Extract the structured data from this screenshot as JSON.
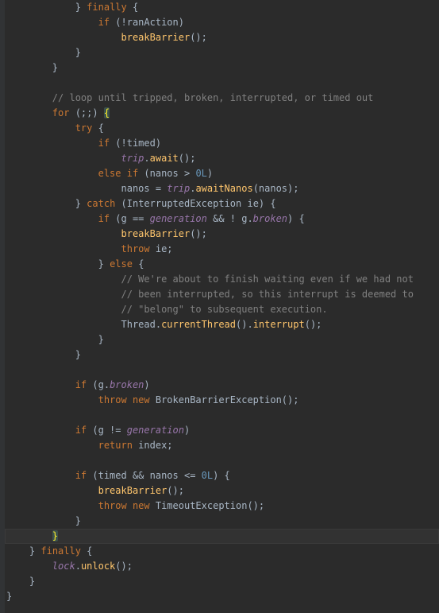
{
  "lines": [
    {
      "indent": "            ",
      "tokens": [
        {
          "t": "}",
          "c": "id"
        },
        {
          "t": " ",
          "c": "id"
        },
        {
          "t": "finally",
          "c": "kw"
        },
        {
          "t": " {",
          "c": "id"
        }
      ]
    },
    {
      "indent": "                ",
      "tokens": [
        {
          "t": "if",
          "c": "kw"
        },
        {
          "t": " (!ranAction)",
          "c": "id"
        }
      ]
    },
    {
      "indent": "                    ",
      "tokens": [
        {
          "t": "breakBarrier",
          "c": "meth"
        },
        {
          "t": "();",
          "c": "id"
        }
      ]
    },
    {
      "indent": "            ",
      "tokens": [
        {
          "t": "}",
          "c": "id"
        }
      ]
    },
    {
      "indent": "        ",
      "tokens": [
        {
          "t": "}",
          "c": "id"
        }
      ]
    },
    {
      "indent": "",
      "tokens": []
    },
    {
      "indent": "        ",
      "tokens": [
        {
          "t": "// loop until tripped, broken, interrupted, or timed out",
          "c": "com"
        }
      ]
    },
    {
      "indent": "        ",
      "tokens": [
        {
          "t": "for",
          "c": "kw"
        },
        {
          "t": " (;;) ",
          "c": "id"
        },
        {
          "t": "{",
          "c": "id",
          "m": true
        }
      ]
    },
    {
      "indent": "            ",
      "tokens": [
        {
          "t": "try",
          "c": "kw"
        },
        {
          "t": " {",
          "c": "id"
        }
      ]
    },
    {
      "indent": "                ",
      "tokens": [
        {
          "t": "if",
          "c": "kw"
        },
        {
          "t": " (!timed)",
          "c": "id"
        }
      ]
    },
    {
      "indent": "                    ",
      "tokens": [
        {
          "t": "trip",
          "c": "fld"
        },
        {
          "t": ".",
          "c": "id"
        },
        {
          "t": "await",
          "c": "meth"
        },
        {
          "t": "();",
          "c": "id"
        }
      ]
    },
    {
      "indent": "                ",
      "tokens": [
        {
          "t": "else if",
          "c": "kw"
        },
        {
          "t": " (nanos ",
          "c": "id"
        },
        {
          "t": ">",
          "c": "id"
        },
        {
          "t": " ",
          "c": "id"
        },
        {
          "t": "0L",
          "c": "num"
        },
        {
          "t": ")",
          "c": "id"
        }
      ]
    },
    {
      "indent": "                    ",
      "tokens": [
        {
          "t": "nanos = ",
          "c": "id"
        },
        {
          "t": "trip",
          "c": "fld"
        },
        {
          "t": ".",
          "c": "id"
        },
        {
          "t": "awaitNanos",
          "c": "meth"
        },
        {
          "t": "(nanos);",
          "c": "id"
        }
      ]
    },
    {
      "indent": "            ",
      "tokens": [
        {
          "t": "}",
          "c": "id"
        },
        {
          "t": " ",
          "c": "id"
        },
        {
          "t": "catch",
          "c": "kw"
        },
        {
          "t": " (InterruptedException ie) {",
          "c": "id"
        }
      ]
    },
    {
      "indent": "                ",
      "tokens": [
        {
          "t": "if",
          "c": "kw"
        },
        {
          "t": " (g == ",
          "c": "id"
        },
        {
          "t": "generation",
          "c": "fld"
        },
        {
          "t": " && ! g.",
          "c": "id"
        },
        {
          "t": "broken",
          "c": "fld"
        },
        {
          "t": ") {",
          "c": "id"
        }
      ]
    },
    {
      "indent": "                    ",
      "tokens": [
        {
          "t": "breakBarrier",
          "c": "meth"
        },
        {
          "t": "();",
          "c": "id"
        }
      ]
    },
    {
      "indent": "                    ",
      "tokens": [
        {
          "t": "throw",
          "c": "kw"
        },
        {
          "t": " ie;",
          "c": "id"
        }
      ]
    },
    {
      "indent": "                ",
      "tokens": [
        {
          "t": "}",
          "c": "id"
        },
        {
          "t": " ",
          "c": "id"
        },
        {
          "t": "else",
          "c": "kw"
        },
        {
          "t": " {",
          "c": "id"
        }
      ]
    },
    {
      "indent": "                    ",
      "tokens": [
        {
          "t": "// We're about to finish waiting even if we had not",
          "c": "com"
        }
      ]
    },
    {
      "indent": "                    ",
      "tokens": [
        {
          "t": "// been interrupted, so this interrupt is deemed to",
          "c": "com"
        }
      ]
    },
    {
      "indent": "                    ",
      "tokens": [
        {
          "t": "// \"belong\" to subsequent execution.",
          "c": "com"
        }
      ]
    },
    {
      "indent": "                    ",
      "tokens": [
        {
          "t": "Thread.",
          "c": "id"
        },
        {
          "t": "currentThread",
          "c": "meth"
        },
        {
          "t": "().",
          "c": "id"
        },
        {
          "t": "interrupt",
          "c": "meth"
        },
        {
          "t": "();",
          "c": "id"
        }
      ]
    },
    {
      "indent": "                ",
      "tokens": [
        {
          "t": "}",
          "c": "id"
        }
      ]
    },
    {
      "indent": "            ",
      "tokens": [
        {
          "t": "}",
          "c": "id"
        }
      ]
    },
    {
      "indent": "",
      "tokens": []
    },
    {
      "indent": "            ",
      "tokens": [
        {
          "t": "if",
          "c": "kw"
        },
        {
          "t": " (g.",
          "c": "id"
        },
        {
          "t": "broken",
          "c": "fld"
        },
        {
          "t": ")",
          "c": "id"
        }
      ]
    },
    {
      "indent": "                ",
      "tokens": [
        {
          "t": "throw new",
          "c": "kw"
        },
        {
          "t": " BrokenBarrierException",
          "c": "id"
        },
        {
          "t": "();",
          "c": "id"
        }
      ]
    },
    {
      "indent": "",
      "tokens": []
    },
    {
      "indent": "            ",
      "tokens": [
        {
          "t": "if",
          "c": "kw"
        },
        {
          "t": " (g != ",
          "c": "id"
        },
        {
          "t": "generation",
          "c": "fld"
        },
        {
          "t": ")",
          "c": "id"
        }
      ]
    },
    {
      "indent": "                ",
      "tokens": [
        {
          "t": "return",
          "c": "kw"
        },
        {
          "t": " index;",
          "c": "id"
        }
      ]
    },
    {
      "indent": "",
      "tokens": []
    },
    {
      "indent": "            ",
      "tokens": [
        {
          "t": "if",
          "c": "kw"
        },
        {
          "t": " (timed && nanos <= ",
          "c": "id"
        },
        {
          "t": "0L",
          "c": "num"
        },
        {
          "t": ") {",
          "c": "id"
        }
      ]
    },
    {
      "indent": "                ",
      "tokens": [
        {
          "t": "breakBarrier",
          "c": "meth"
        },
        {
          "t": "();",
          "c": "id"
        }
      ]
    },
    {
      "indent": "                ",
      "tokens": [
        {
          "t": "throw new",
          "c": "kw"
        },
        {
          "t": " TimeoutException",
          "c": "id"
        },
        {
          "t": "();",
          "c": "id"
        }
      ]
    },
    {
      "indent": "            ",
      "tokens": [
        {
          "t": "}",
          "c": "id"
        }
      ]
    },
    {
      "indent": "        ",
      "highlight": true,
      "tokens": [
        {
          "t": "}",
          "c": "id",
          "m": true
        }
      ]
    },
    {
      "indent": "    ",
      "tokens": [
        {
          "t": "}",
          "c": "id"
        },
        {
          "t": " ",
          "c": "id"
        },
        {
          "t": "finally",
          "c": "kw"
        },
        {
          "t": " {",
          "c": "id"
        }
      ]
    },
    {
      "indent": "        ",
      "tokens": [
        {
          "t": "lock",
          "c": "fld"
        },
        {
          "t": ".",
          "c": "id"
        },
        {
          "t": "unlock",
          "c": "meth"
        },
        {
          "t": "();",
          "c": "id"
        }
      ]
    },
    {
      "indent": "    ",
      "tokens": [
        {
          "t": "}",
          "c": "id"
        }
      ]
    },
    {
      "indent": "",
      "tokens": [
        {
          "t": "}",
          "c": "id"
        }
      ]
    }
  ]
}
